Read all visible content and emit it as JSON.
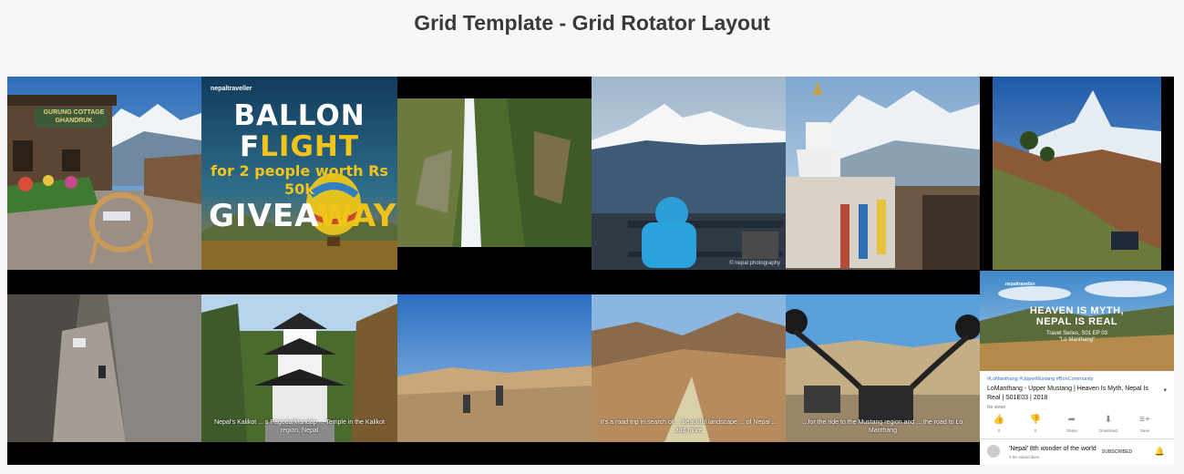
{
  "page": {
    "title": "Grid Template - Grid Rotator Layout"
  },
  "tiles": {
    "gurung": {
      "sign": "GURUNG COTTAGE\nGHANDRUK",
      "sign_l1": "GURUNG COTTAGE",
      "sign_l2": "GHANDRUK"
    },
    "ballon": {
      "brand": "nepaltraveller",
      "line1_a": "BALLON F",
      "line1_b": "LIGHT",
      "line2": "for 2 people worth Rs 50k",
      "line3_a": "GIVEA",
      "line3_b": "WAY",
      "line3_c": "!!"
    },
    "bench": {
      "watermark": "© nepal photography"
    },
    "pagoda": {
      "caption": "Nepal's Kalikot ... s Pagoda/Mandap ... Temple in the Kalikot region, Nepal"
    },
    "valley": {
      "caption": "It's a road trip in search of ... beautiful landscape ... of Nepal ... and more"
    },
    "bike": {
      "caption": "...for the ride to the Mustang region and ... the road to Lo Manthang"
    }
  },
  "youtube_card": {
    "thumb_brand": "nepaltraveller",
    "thumb_headline_1": "HEAVEN IS MYTH,",
    "thumb_headline_2": "NEPAL IS REAL",
    "thumb_sub_1": "Travel Series, S01 EP 03",
    "thumb_sub_2": "\"Lo Manthang\"",
    "hashtags": "#LoManthang #UpperMustang #BonCommunity",
    "video_title": "LoManthang - Upper Mustang | Heaven Is Myth, Nepal Is Real | S01E03 | 2018",
    "views": "No views",
    "actions": [
      {
        "icon": "thumbs-up-icon",
        "glyph": "👍",
        "label": "0"
      },
      {
        "icon": "thumbs-down-icon",
        "glyph": "👎",
        "label": "0"
      },
      {
        "icon": "share-icon",
        "glyph": "➦",
        "label": "Share"
      },
      {
        "icon": "download-icon",
        "glyph": "⬇",
        "label": "Download"
      },
      {
        "icon": "save-icon",
        "glyph": "≡+",
        "label": "Save"
      }
    ],
    "channel_name": "'Nepal' 8th wonder of the world",
    "channel_subs": "4.5K subscribers",
    "subscribe_label": "SUBSCRIBED",
    "caret": "▾",
    "bell": "🔔"
  },
  "colors": {
    "background": "#f5f7f8",
    "title": "#3a3a3a",
    "grid_bg": "#000000",
    "accent_yellow": "#f2c319"
  }
}
